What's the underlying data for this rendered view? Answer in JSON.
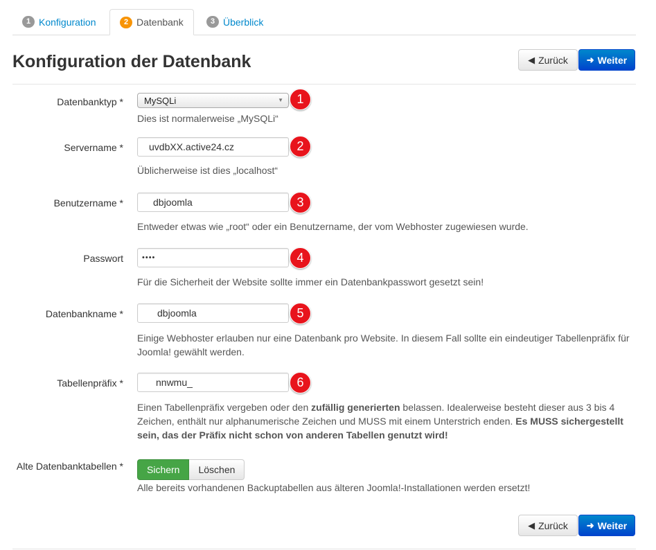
{
  "tabs": [
    {
      "num": "1",
      "label": "Konfiguration"
    },
    {
      "num": "2",
      "label": "Datenbank"
    },
    {
      "num": "3",
      "label": "Überblick"
    }
  ],
  "title": "Konfiguration der Datenbank",
  "buttons": {
    "back": "Zurück",
    "next": "Weiter"
  },
  "fields": {
    "dbtype": {
      "label": "Datenbanktyp *",
      "value": "MySQLi",
      "help": "Dies ist normalerweise „MySQLi“",
      "marker": "1"
    },
    "server": {
      "label": "Servername *",
      "value": "uvdbXX.active24.cz",
      "help": "Üblicherweise ist dies „localhost“",
      "marker": "2"
    },
    "user": {
      "label": "Benutzername *",
      "value": "dbjoomla",
      "help": "Entweder etwas wie „root“ oder ein Benutzername, der vom Webhoster zugewiesen wurde.",
      "marker": "3"
    },
    "password": {
      "label": "Passwort",
      "value": "••••",
      "help": "Für die Sicherheit der Website sollte immer ein Datenbankpasswort gesetzt sein!",
      "marker": "4"
    },
    "dbname": {
      "label": "Datenbankname *",
      "value": "dbjoomla",
      "help1": "Einige Webhoster erlauben nur eine Datenbank pro Website. In diesem Fall sollte ein eindeutiger Tabellenpräfix für",
      "help2": "Joomla! gewählt werden.",
      "marker": "5"
    },
    "prefix": {
      "label": "Tabellenpräfix *",
      "value": "nnwmu_",
      "marker": "6",
      "help_a": "Einen Tabellenpräfix vergeben oder den ",
      "help_b": "zufällig generierten",
      "help_c": " belassen. Idealerweise besteht dieser aus 3 bis 4",
      "help_d": "Zeichen, enthält nur alphanumerische Zeichen und MUSS mit einem Unterstrich enden. ",
      "help_e": "Es MUSS sichergestellt",
      "help_f": "sein, das der Präfix nicht schon von anderen Tabellen genutzt wird!"
    },
    "old": {
      "label": "Alte Datenbanktabellen *",
      "on": "Sichern",
      "off": "Löschen",
      "help": "Alle bereits vorhandenen Backuptabellen aus älteren Joomla!-Installationen werden ersetzt!"
    }
  }
}
